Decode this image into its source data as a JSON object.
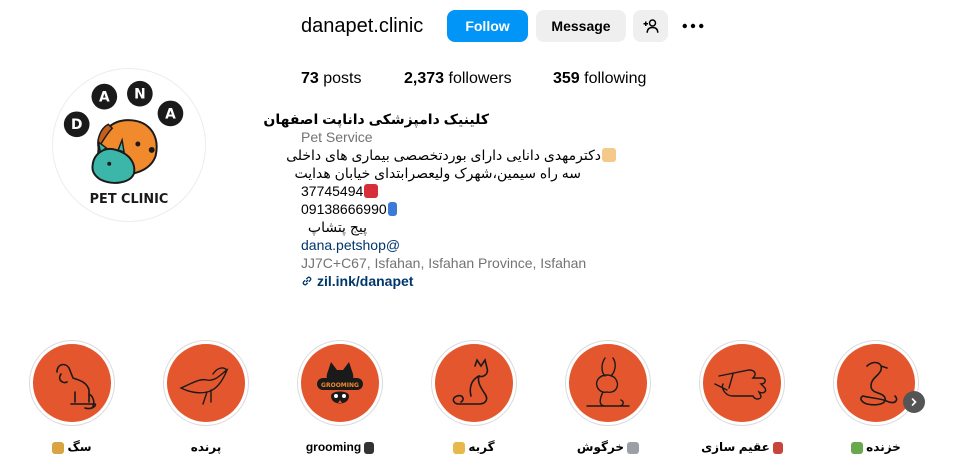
{
  "profile": {
    "username": "danapet.clinic",
    "avatar_logo_text_top": [
      "D",
      "A",
      "N",
      "A"
    ],
    "avatar_logo_text_bottom": "PET CLINIC"
  },
  "actions": {
    "follow_label": "Follow",
    "message_label": "Message",
    "add_icon": "person-add-icon",
    "more_icon": "more-horizontal-icon"
  },
  "stats": {
    "posts_count": "73",
    "posts_label": " posts",
    "followers_count": "2,373",
    "followers_label": " followers",
    "following_count": "359",
    "following_label": " following"
  },
  "bio": {
    "name": "کلینیک دامپزشکی داناپت اصفهان",
    "category": "Pet Service",
    "line1": "دکترمهدی دانایی دارای بوردتخصصی بیماری های داخلی",
    "line2": "سه راه سیمین،شهرک ولیعصرابتدای خیابان هدایت",
    "phone1": "37745494",
    "phone2": "09138666990",
    "shop_text": "پیج پتشاپ",
    "shop_handle": "dana.petshop@",
    "address": "JJ7C+C67, Isfahan, Isfahan Province, Isfahan",
    "link": "zil.ink/danapet"
  },
  "highlights": [
    {
      "label": "سگ",
      "icon": "dog-emoji-icon"
    },
    {
      "label": "پرنده",
      "icon": ""
    },
    {
      "label": "grooming",
      "icon": "scissors-icon"
    },
    {
      "label": "گربه",
      "icon": "cat-emoji-icon"
    },
    {
      "label": "خرگوش",
      "icon": "rabbit-emoji-icon"
    },
    {
      "label": "عقیم سازی",
      "icon": "syringe-icon"
    },
    {
      "label": "خزنده",
      "icon": "turtle-emoji-icon"
    }
  ],
  "colors": {
    "accent": "#0095f6",
    "highlight_bg": "#e4572e",
    "logo_orange": "#f08a2c",
    "logo_teal": "#3cb6a8"
  }
}
